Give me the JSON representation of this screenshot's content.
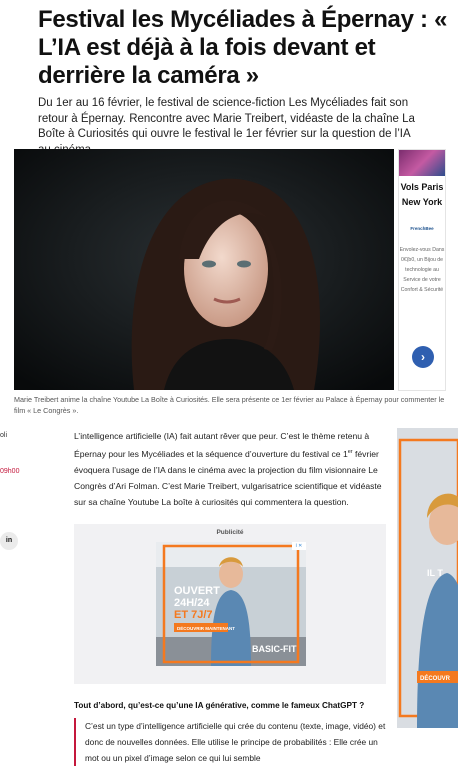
{
  "article": {
    "headline": "Festival les Mycéliades à Épernay : « L’IA est déjà à la fois devant et derrière la caméra »",
    "lede": "Du 1er au 16 février, le festival de science-fiction Les Mycéliades fait son retour à Épernay. Rencontre avec Marie Treibert, vidéaste de la chaîne La Boîte à Curiosités qui ouvre le festival le 1er février sur la question de l’IA au cinéma.",
    "caption": "Marie Treibert anime la chaîne Youtube La Boîte à Curiosités. Elle sera présente ce 1er février au Palace à Épernay pour commenter le film « Le Congrès ».",
    "body_p1_a": "L’intelligence artificielle (IA) fait autant rêver que peur. C’est le thème retenu à Épernay pour les Mycéliades et la séquence d’ouverture du festival ce 1",
    "body_p1_sup": "er",
    "body_p1_b": " février évoquera l’usage de l’IA dans le cinéma avec la projection du film visionnaire Le Congrès d’Ari Folman. C’est Marie Treibert, vulgarisatrice scientifique et vidéaste sur sa chaîne Youtube La boîte à curiosités qui commentera la question.",
    "question": "Tout d’abord, qu’est-ce qu’une IA générative, comme le fameux ChatGPT ?",
    "answer": "C’est un type d’intelligence artificielle qui crée du contenu (texte, image, vidéo) et donc de nouvelles données. Elle utilise le principe de probabilités : Elle crée un mot ou un pixel d’image selon ce qui lui semble"
  },
  "share": {
    "label_top": "oli",
    "label_time": "09h00",
    "linkedin_glyph": "in"
  },
  "side_ad": {
    "title": "Vols Paris New York",
    "brand": "FrenchBee",
    "description": "Envolez-vous Dans 0€(b0, un Bijou de technologie au Service de votre Confort & Sécurité",
    "arrow": "›"
  },
  "pub": {
    "label": "Publicité",
    "ad_line1": "OUVERT",
    "ad_line2": "24H/24",
    "ad_line3": "ET 7J/7",
    "ad_cta": "DÉCOUVRIR MAINTENANT",
    "ad_brand": "BASIC-FIT",
    "ad_badge": "i ✕"
  },
  "right_ad": {
    "text1": "IL T",
    "text2": "DÉCOUVR"
  },
  "colors": {
    "accent": "#c4183c",
    "ad_orange": "#f4791f"
  }
}
